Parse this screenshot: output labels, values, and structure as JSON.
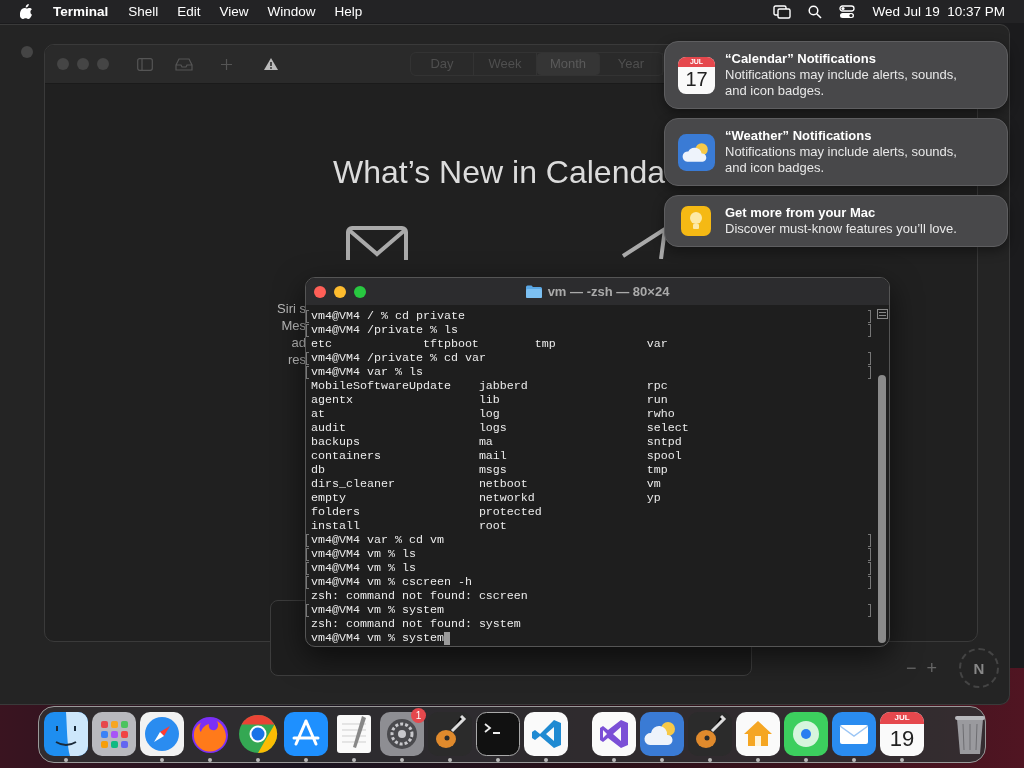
{
  "menu_bar": {
    "app": "Terminal",
    "menus": [
      "Shell",
      "Edit",
      "View",
      "Window",
      "Help"
    ],
    "clock": "Wed Jul 19  10:37 PM"
  },
  "maps_window": {
    "zoom_out": "−",
    "zoom_in": "+",
    "compass": "N"
  },
  "calendar_window": {
    "view_tabs": [
      {
        "label": "Day",
        "selected": false
      },
      {
        "label": "Week",
        "selected": false
      },
      {
        "label": "Month",
        "selected": true
      },
      {
        "label": "Year",
        "selected": false
      }
    ],
    "heading": "What’s New in Calenda",
    "feature_text": [
      "Siri s",
      "Mes",
      "ad",
      "res"
    ]
  },
  "terminal": {
    "title": "vm — -zsh — 80×24",
    "lines": [
      {
        "kind": "prompt",
        "text": "vm4@VM4 / % cd private"
      },
      {
        "kind": "prompt",
        "text": "vm4@VM4 /private % ls"
      },
      {
        "kind": "columns",
        "cells": [
          "etc",
          "tftpboot",
          "tmp",
          "var"
        ]
      },
      {
        "kind": "prompt",
        "text": "vm4@VM4 /private % cd var"
      },
      {
        "kind": "prompt",
        "text": "vm4@VM4 var % ls"
      },
      {
        "kind": "columns",
        "cells": [
          "MobileSoftwareUpdate",
          "jabberd",
          "rpc"
        ]
      },
      {
        "kind": "columns",
        "cells": [
          "agentx",
          "lib",
          "run"
        ]
      },
      {
        "kind": "columns",
        "cells": [
          "at",
          "log",
          "rwho"
        ]
      },
      {
        "kind": "columns",
        "cells": [
          "audit",
          "logs",
          "select"
        ]
      },
      {
        "kind": "columns",
        "cells": [
          "backups",
          "ma",
          "sntpd"
        ]
      },
      {
        "kind": "columns",
        "cells": [
          "containers",
          "mail",
          "spool"
        ]
      },
      {
        "kind": "columns",
        "cells": [
          "db",
          "msgs",
          "tmp"
        ]
      },
      {
        "kind": "columns",
        "cells": [
          "dirs_cleaner",
          "netboot",
          "vm"
        ]
      },
      {
        "kind": "columns",
        "cells": [
          "empty",
          "networkd",
          "yp"
        ]
      },
      {
        "kind": "columns",
        "cells": [
          "folders",
          "protected"
        ]
      },
      {
        "kind": "columns",
        "cells": [
          "install",
          "root"
        ]
      },
      {
        "kind": "prompt",
        "text": "vm4@VM4 var % cd vm"
      },
      {
        "kind": "prompt",
        "text": "vm4@VM4 vm % ls"
      },
      {
        "kind": "prompt",
        "text": "vm4@VM4 vm % ls"
      },
      {
        "kind": "prompt",
        "text": "vm4@VM4 vm % cscreen -h"
      },
      {
        "kind": "output",
        "text": "zsh: command not found: cscreen"
      },
      {
        "kind": "prompt",
        "text": "vm4@VM4 vm % system"
      },
      {
        "kind": "output",
        "text": "zsh: command not found: system"
      },
      {
        "kind": "input",
        "text": "vm4@VM4 vm % system",
        "cursor": true
      }
    ]
  },
  "notifications": [
    {
      "kind": "calendar",
      "title": "“Calendar” Notifications",
      "body": "Notifications may include alerts, sounds, and icon badges.",
      "icon_month": "JUL",
      "icon_day": "17"
    },
    {
      "kind": "weather",
      "title": "“Weather” Notifications",
      "body": "Notifications may include alerts, sounds, and icon badges."
    },
    {
      "kind": "tips",
      "title": "Get more from your Mac",
      "body": "Discover must-know features you’ll love."
    }
  ],
  "dock": {
    "sections": [
      {
        "items": [
          {
            "kind": "finder",
            "running": true
          },
          {
            "kind": "launchpad",
            "running": false
          },
          {
            "kind": "safari",
            "running": true
          },
          {
            "kind": "firefox",
            "running": true
          },
          {
            "kind": "chrome",
            "running": true
          },
          {
            "kind": "appstore",
            "running": true
          },
          {
            "kind": "textedit",
            "running": true
          },
          {
            "kind": "settings",
            "running": true,
            "badge": "1"
          },
          {
            "kind": "garageband",
            "running": true
          },
          {
            "kind": "terminal",
            "running": true
          },
          {
            "kind": "vscode",
            "running": true
          }
        ]
      },
      {
        "items": [
          {
            "kind": "visualstudio",
            "running": true
          },
          {
            "kind": "weather",
            "running": true
          },
          {
            "kind": "garageband",
            "running": true
          },
          {
            "kind": "home",
            "running": true
          },
          {
            "kind": "findmy",
            "running": true
          },
          {
            "kind": "mail",
            "running": true
          },
          {
            "kind": "calendar",
            "running": true,
            "month": "JUL",
            "day": "19"
          }
        ]
      },
      {
        "items": [
          {
            "kind": "trash",
            "running": false
          }
        ]
      }
    ]
  }
}
